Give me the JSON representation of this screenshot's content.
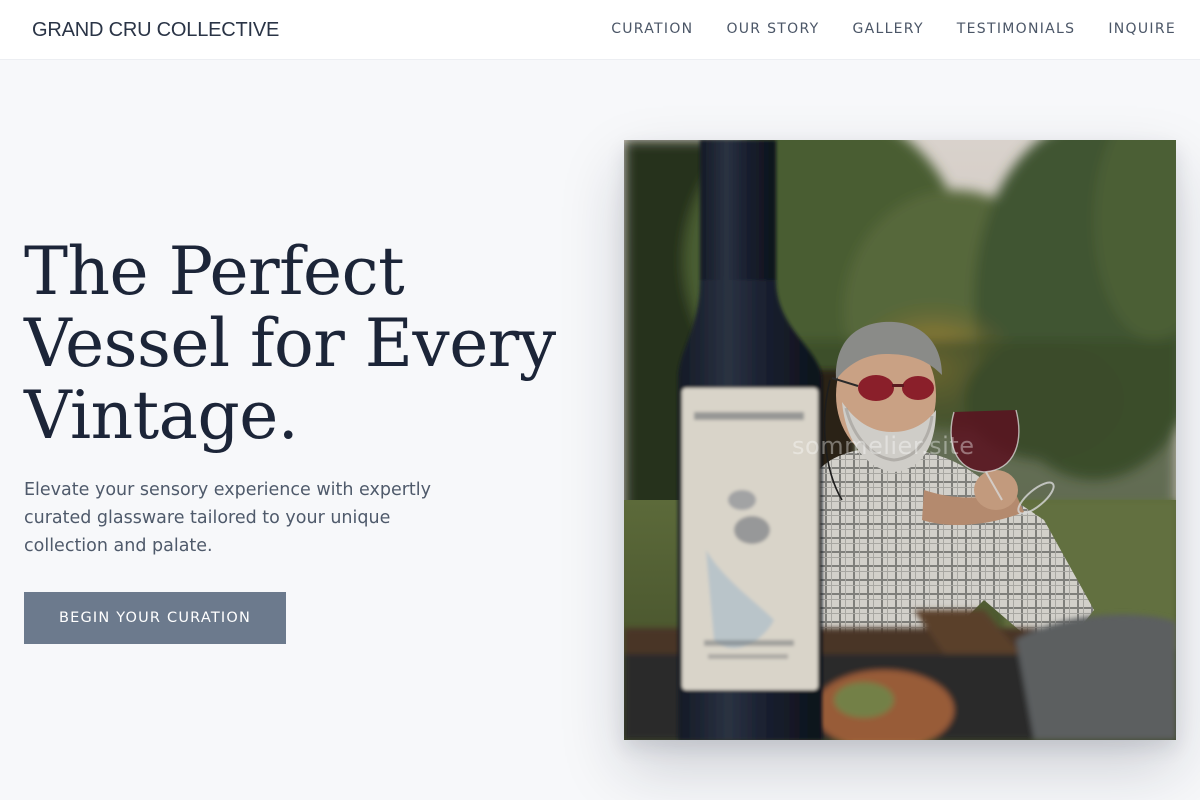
{
  "header": {
    "brand": "GRAND CRU COLLECTIVE",
    "nav": [
      {
        "label": "CURATION"
      },
      {
        "label": "OUR STORY"
      },
      {
        "label": "GALLERY"
      },
      {
        "label": "TESTIMONIALS"
      },
      {
        "label": "INQUIRE"
      }
    ]
  },
  "hero": {
    "title": "The Perfect Vessel for Every Vintage.",
    "subtitle": "Elevate your sensory experience with expertly curated glassware tailored to your unique collection and palate.",
    "cta_label": "BEGIN YOUR CURATION",
    "image": {
      "alt": "Man with grey beard and sunglasses sipping red wine outdoors, a wine bottle blurred in the foreground",
      "watermark": "sommelier.site"
    }
  },
  "colors": {
    "page_background": "#f7f8fa",
    "header_background": "#ffffff",
    "heading": "#1c2538",
    "body_text": "#4f5a6b",
    "nav_text": "#4b5667",
    "cta_background": "#6c7a8d",
    "cta_text": "#ffffff"
  }
}
